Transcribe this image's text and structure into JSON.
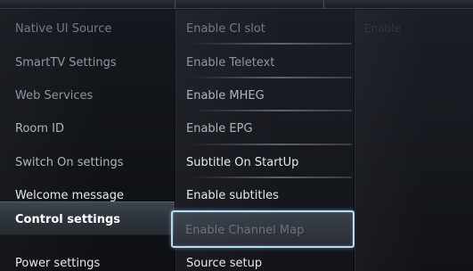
{
  "menu": {
    "col1_items": [
      {
        "label": "Native UI Source"
      },
      {
        "label": "SmartTV Settings"
      },
      {
        "label": "Web Services"
      },
      {
        "label": "Room ID"
      },
      {
        "label": "Switch On settings"
      },
      {
        "label": "Welcome message"
      },
      {
        "label": "Control settings"
      },
      {
        "label": "Power settings"
      }
    ],
    "col1_selected_index": 6,
    "col2_items": [
      {
        "label": "Enable CI slot"
      },
      {
        "label": "Enable Teletext"
      },
      {
        "label": "Enable MHEG"
      },
      {
        "label": "Enable EPG"
      },
      {
        "label": "Subtitle On StartUp"
      },
      {
        "label": "Enable subtitles"
      },
      {
        "label": "Enable Channel Map"
      },
      {
        "label": "Source setup"
      }
    ],
    "col2_focused_index": 6,
    "col3_text": "Enable"
  },
  "colors": {
    "focus_border": "#b9dcf5",
    "selected_bg": "#3f4650",
    "background": "#07080b"
  }
}
